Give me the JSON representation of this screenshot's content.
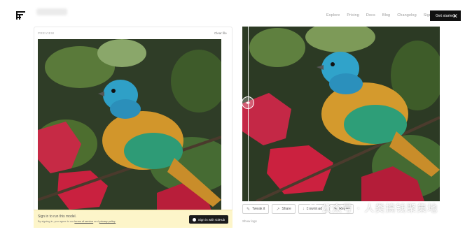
{
  "header": {
    "logo_icon": "stacked-lines-logo-icon",
    "nav": [
      "Explore",
      "Pricing",
      "Docs",
      "Blog",
      "Changelog",
      "Sign in"
    ],
    "cta_label": "Get started",
    "close_icon": "close-icon"
  },
  "left_panel": {
    "preview_label": "PREVIEW",
    "clear_label": "Clear file",
    "notice_title": "Sign in to run this model.",
    "notice_sub_prefix": "By signing in, you agree to our",
    "terms_label": "terms of service",
    "notice_and": "and",
    "privacy_label": "privacy policy.",
    "github_button": "Sign in with GitHub"
  },
  "right_panel": {
    "compare_handle_icon": "compare-arrows-icon",
    "actions": [
      {
        "label": "Tweak it",
        "icon": "tweak-icon"
      },
      {
        "label": "Share",
        "icon": "share-icon"
      },
      {
        "label": "Download",
        "icon": "download-icon"
      },
      {
        "label": "Report",
        "icon": "report-icon"
      }
    ],
    "show_logs": "Show logs"
  },
  "watermark": {
    "text": "公众号 · 人类搞钱聚集地"
  },
  "colors": {
    "accent_dark": "#111111",
    "notice_bg": "#fdf5c9"
  }
}
